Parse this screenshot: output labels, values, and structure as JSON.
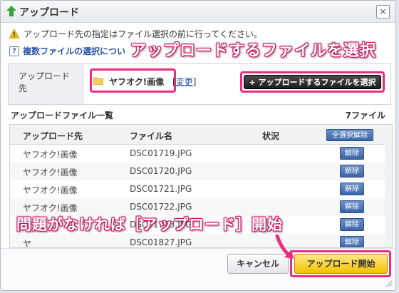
{
  "dialog": {
    "title": "アップロード",
    "close_label": "×",
    "notice": "アップロード先の指定はファイル選択の前に行ってください。",
    "help_link": "複数ファイルの選択につい"
  },
  "callouts": {
    "top": "アップロードするファイルを選択",
    "bottom": "問題がなければ［アップロード］開始"
  },
  "destination": {
    "label": "アップロード先",
    "folder_name": "ヤフオク!画像",
    "change_open": "[",
    "change_label": "変更",
    "change_close": "]",
    "select_button": "+ アップロードするファイルを選択"
  },
  "file_list": {
    "header": "アップロードファイル一覧",
    "count": "7ファイル",
    "columns": [
      "アップロード先",
      "ファイル名",
      "状況"
    ],
    "select_all_label": "全選択解除",
    "delete_label": "解除",
    "rows": [
      {
        "dest": "ヤフオク!画像",
        "file": "DSC01719.JPG"
      },
      {
        "dest": "ヤフオク!画像",
        "file": "DSC01720.JPG"
      },
      {
        "dest": "ヤフオク!画像",
        "file": "DSC01721.JPG"
      },
      {
        "dest": "ヤフオク!画像",
        "file": "DSC01722.JPG"
      },
      {
        "dest": "ヤ",
        "file": "DSC01723.JPG"
      },
      {
        "dest": "ヤ",
        "file": "DSC01827.JPG"
      }
    ]
  },
  "footer": {
    "cancel_label": "キャンセル",
    "upload_label": "アップロード開始"
  },
  "colors": {
    "highlight": "#ec2d7f",
    "upload_button": "#f3c200",
    "action_blue": "#3864a9"
  }
}
